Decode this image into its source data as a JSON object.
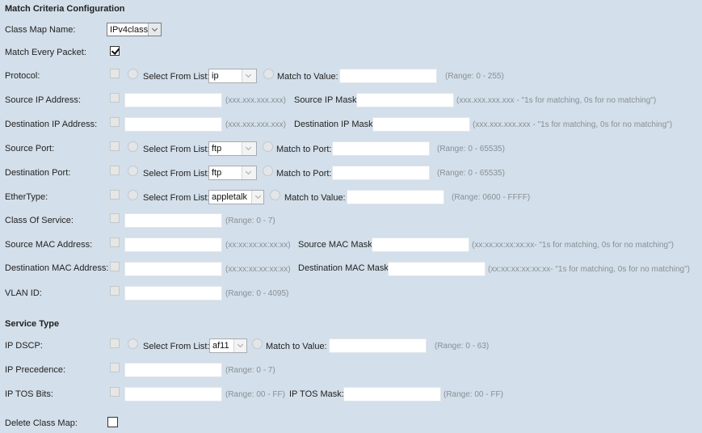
{
  "section_match": "Match Criteria Configuration",
  "section_service": "Service Type",
  "class_map": {
    "label": "Class Map Name:",
    "value": "IPv4class"
  },
  "match_every": {
    "label": "Match Every Packet:",
    "checked": true
  },
  "common": {
    "select_from_list": "Select From List:",
    "match_to_value": "Match to Value:",
    "match_to_port": "Match to Port:"
  },
  "protocol": {
    "label": "Protocol:",
    "select": "ip",
    "value": "",
    "hint": "(Range: 0 - 255)"
  },
  "src_ip": {
    "label": "Source IP Address:",
    "value": "",
    "hint": "(xxx.xxx.xxx.xxx)",
    "mask_label": "Source IP Mask:",
    "mask_value": "",
    "mask_hint": "(xxx.xxx.xxx.xxx - \"1s for matching, 0s for no matching\")"
  },
  "dst_ip": {
    "label": "Destination IP Address:",
    "value": "",
    "hint": "(xxx.xxx.xxx.xxx)",
    "mask_label": "Destination IP Mask:",
    "mask_value": "",
    "mask_hint": "(xxx.xxx.xxx.xxx - \"1s for matching, 0s for no matching\")"
  },
  "src_port": {
    "label": "Source Port:",
    "select": "ftp",
    "value": "",
    "hint": "(Range: 0 - 65535)"
  },
  "dst_port": {
    "label": "Destination Port:",
    "select": "ftp",
    "value": "",
    "hint": "(Range: 0 - 65535)"
  },
  "ethertype": {
    "label": "EtherType:",
    "select": "appletalk",
    "value": "",
    "hint": "(Range: 0600 - FFFF)"
  },
  "cos": {
    "label": "Class Of Service:",
    "value": "",
    "hint": "(Range: 0 - 7)"
  },
  "src_mac": {
    "label": "Source MAC Address:",
    "value": "",
    "hint": "(xx:xx:xx:xx:xx:xx)",
    "mask_label": "Source MAC Mask:",
    "mask_value": "",
    "mask_hint": "(xx:xx:xx:xx:xx:xx- \"1s for matching, 0s for no matching\")"
  },
  "dst_mac": {
    "label": "Destination MAC Address:",
    "value": "",
    "hint": "(xx:xx:xx:xx:xx:xx)",
    "mask_label": "Destination MAC Mask:",
    "mask_value": "",
    "mask_hint": "(xx:xx:xx:xx:xx:xx- \"1s for matching, 0s for no matching\")"
  },
  "vlan": {
    "label": "VLAN ID:",
    "value": "",
    "hint": "(Range: 0 - 4095)"
  },
  "dscp": {
    "label": "IP DSCP:",
    "select": "af11",
    "value": "",
    "hint": "(Range: 0 - 63)"
  },
  "precedence": {
    "label": "IP Precedence:",
    "value": "",
    "hint": "(Range: 0 - 7)"
  },
  "tos": {
    "label": "IP TOS Bits:",
    "value": "",
    "hint": "(Range: 00 - FF)",
    "mask_label": "IP TOS Mask:",
    "mask_value": "",
    "mask_hint": "(Range: 00 - FF)"
  },
  "delete": {
    "label": "Delete Class Map:",
    "checked": false
  }
}
